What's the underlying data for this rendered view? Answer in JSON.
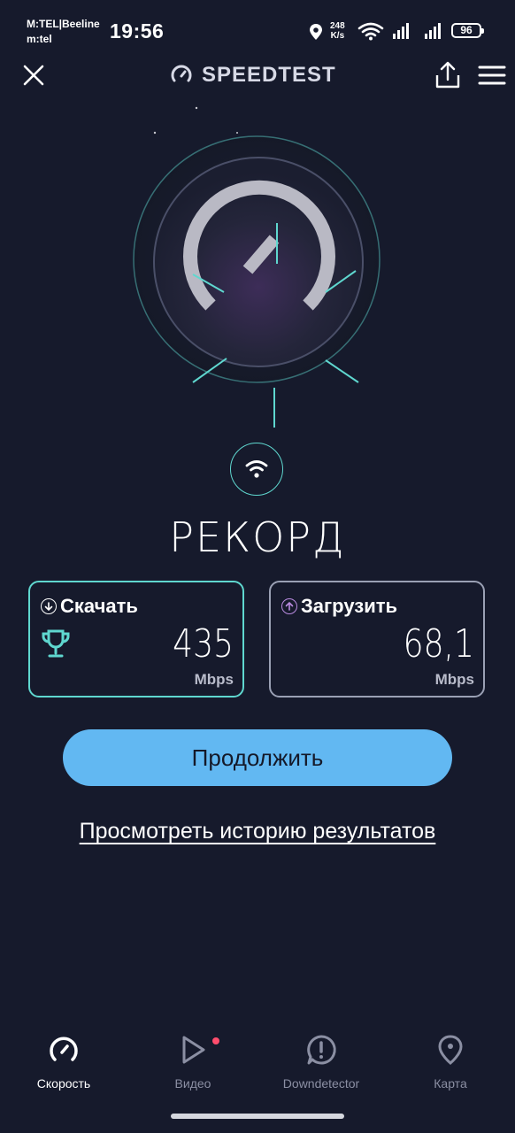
{
  "status_bar": {
    "carrier_line1": "M:TEL|Beeline",
    "carrier_line2": "m:tel",
    "time": "19:56",
    "net_speed_value": "248",
    "net_speed_unit": "K/s",
    "battery": "96"
  },
  "header": {
    "title": "SPEEDTEST"
  },
  "result": {
    "title": "РЕКОРД"
  },
  "download": {
    "label": "Скачать",
    "value": "435",
    "unit": "Mbps"
  },
  "upload": {
    "label": "Загрузить",
    "value": "68,1",
    "unit": "Mbps"
  },
  "continue_button": "Продолжить",
  "history_link": "Просмотреть историю результатов",
  "bottom_nav": [
    {
      "label": "Скорость",
      "icon": "speedometer-icon",
      "active": true
    },
    {
      "label": "Видео",
      "icon": "play-icon",
      "active": false
    },
    {
      "label": "Downdetector",
      "icon": "alert-icon",
      "active": false
    },
    {
      "label": "Карта",
      "icon": "map-pin-icon",
      "active": false
    }
  ],
  "colors": {
    "background": "#161a2c",
    "accent_teal": "#5fd7cf",
    "button_blue": "#62b8f2",
    "upload_purple": "#b98be0",
    "notification_dot": "#ff4d6d"
  }
}
